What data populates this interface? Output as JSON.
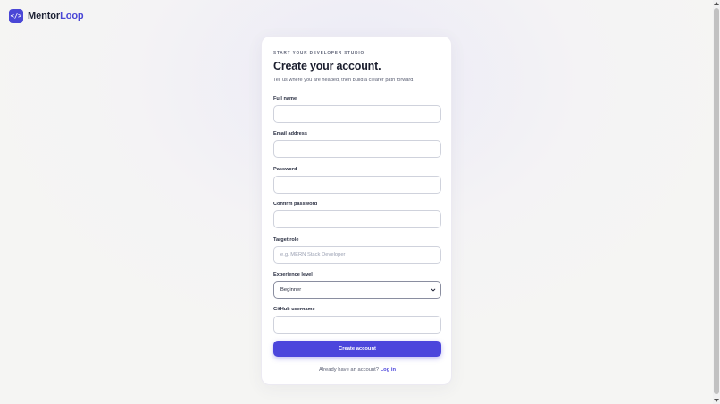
{
  "brand": {
    "logo_glyph": "</>",
    "name_part1": "Mentor",
    "name_part2": "Loop",
    "accent_color": "#4a47d6"
  },
  "form": {
    "eyebrow": "START YOUR DEVELOPER STUDIO",
    "title": "Create your account.",
    "subtitle": "Tell us where you are headed, then build a clearer path forward.",
    "fields": {
      "full_name": {
        "label": "Full name",
        "value": "",
        "placeholder": ""
      },
      "email": {
        "label": "Email address",
        "value": "",
        "placeholder": ""
      },
      "password": {
        "label": "Password",
        "value": "",
        "placeholder": ""
      },
      "confirm_password": {
        "label": "Confirm password",
        "value": "",
        "placeholder": ""
      },
      "target_role": {
        "label": "Target role",
        "value": "",
        "placeholder": "e.g. MERN Stack Developer"
      },
      "experience_level": {
        "label": "Experience level",
        "selected": "Beginner"
      },
      "github": {
        "label": "GitHub username",
        "value": "",
        "placeholder": ""
      }
    },
    "submit_label": "Create account",
    "footer_prompt": "Already have an account?",
    "footer_link": "Log in"
  },
  "icons": {
    "select": "chevron-down-icon"
  }
}
